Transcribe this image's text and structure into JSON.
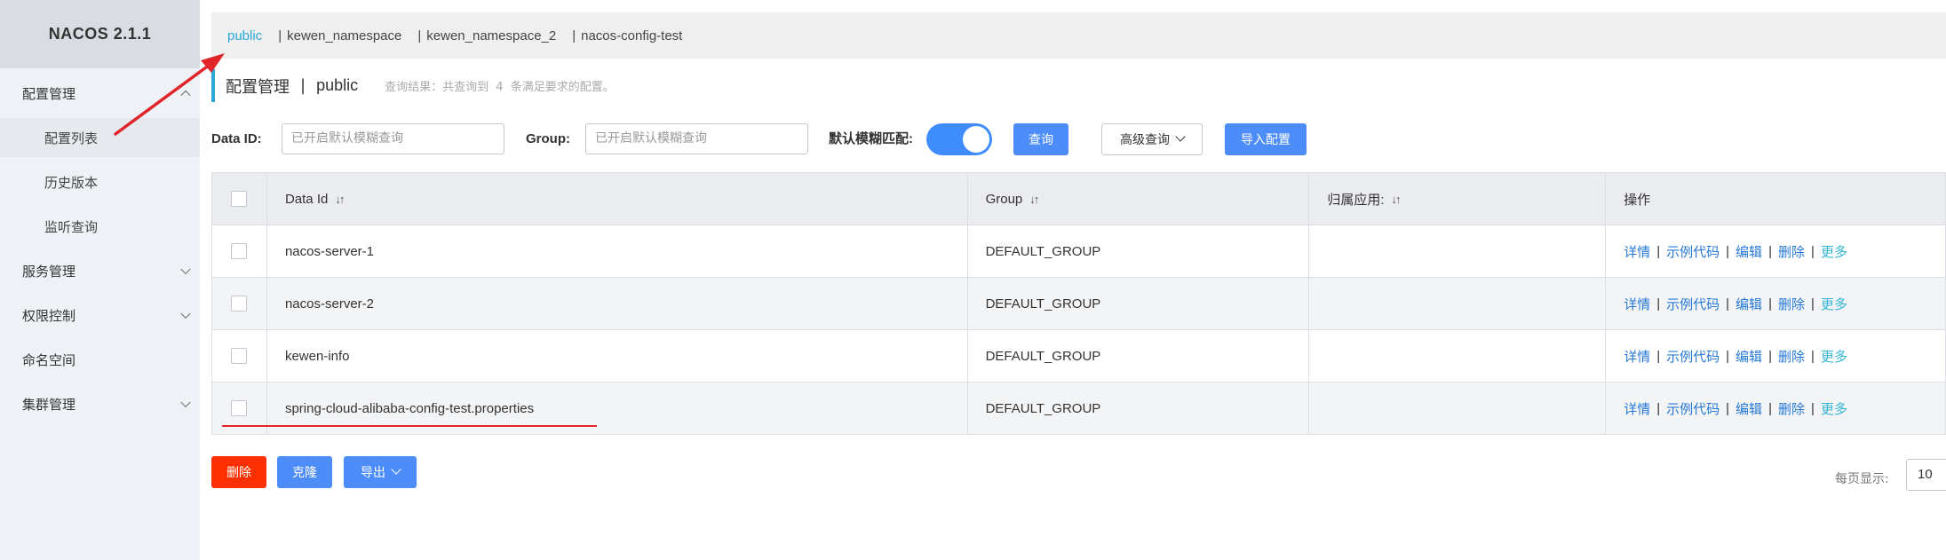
{
  "app": {
    "logo_text": "NACOS 2.1.1"
  },
  "sidebar": {
    "items": [
      {
        "label": "配置管理",
        "type": "group",
        "expanded": true
      },
      {
        "label": "配置列表",
        "type": "sub",
        "active": true
      },
      {
        "label": "历史版本",
        "type": "sub"
      },
      {
        "label": "监听查询",
        "type": "sub"
      },
      {
        "label": "服务管理",
        "type": "group"
      },
      {
        "label": "权限控制",
        "type": "group"
      },
      {
        "label": "命名空间",
        "type": "link"
      },
      {
        "label": "集群管理",
        "type": "group"
      }
    ]
  },
  "namespaces": {
    "items": [
      {
        "label": "public",
        "active": true
      },
      {
        "label": "kewen_namespace"
      },
      {
        "label": "kewen_namespace_2"
      },
      {
        "label": "nacos-config-test"
      }
    ],
    "separator": "|"
  },
  "page": {
    "title": "配置管理",
    "title_separator": "|",
    "namespace": "public",
    "query_result_prefix": "查询结果：共查询到",
    "query_result_count": "4",
    "query_result_suffix": "条满足要求的配置。"
  },
  "search": {
    "data_id_label": "Data ID:",
    "data_id_placeholder": "已开启默认模糊查询",
    "group_label": "Group:",
    "group_placeholder": "已开启默认模糊查询",
    "fuzzy_label": "默认模糊匹配:",
    "fuzzy_enabled": true,
    "query_button": "查询",
    "advanced_button": "高级查询",
    "import_button": "导入配置"
  },
  "table": {
    "columns": {
      "data_id": "Data Id",
      "group": "Group",
      "app": "归属应用:",
      "ops": "操作"
    },
    "sort_icon": "↓↑",
    "rows": [
      {
        "data_id": "nacos-server-1",
        "group": "DEFAULT_GROUP",
        "app": ""
      },
      {
        "data_id": "nacos-server-2",
        "group": "DEFAULT_GROUP",
        "app": ""
      },
      {
        "data_id": "kewen-info",
        "group": "DEFAULT_GROUP",
        "app": ""
      },
      {
        "data_id": "spring-cloud-alibaba-config-test.properties",
        "group": "DEFAULT_GROUP",
        "app": ""
      }
    ],
    "ops": {
      "detail": "详情",
      "sample": "示例代码",
      "edit": "编辑",
      "delete": "删除",
      "more": "更多",
      "separator": "|"
    }
  },
  "footer": {
    "delete_button": "删除",
    "clone_button": "克隆",
    "export_button": "导出",
    "page_size_label": "每页显示:",
    "page_size_value": "10"
  },
  "colors": {
    "accent": "#2aa8d8",
    "primary_button": "#4d8dfa",
    "danger_button": "#ff3000",
    "annotation_red": "#e0262b"
  }
}
